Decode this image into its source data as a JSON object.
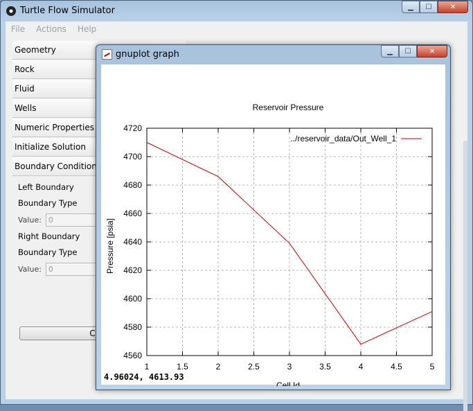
{
  "main": {
    "title": "Turtle Flow Simulator",
    "menu": [
      "File",
      "Actions",
      "Help"
    ],
    "sections": [
      "Geometry",
      "Rock",
      "Fluid",
      "Wells",
      "Numeric Properties",
      "Initialize Solution",
      "Boundary Condition"
    ],
    "boundary": {
      "left_label": "Left Boundary",
      "left_type_label": "Boundary Type",
      "left_value_label": "Value:",
      "left_value": "0",
      "right_label": "Right Boundary",
      "right_type_label": "Boundary Type",
      "right_value_label": "Value:",
      "right_value": "0"
    },
    "create_button": "Crea"
  },
  "gnuplot": {
    "title": "gnuplot graph",
    "coords": "4.96024,  4613.93"
  },
  "chart_data": {
    "type": "line",
    "title": "Reservoir Pressure",
    "xlabel": "Cell Id",
    "ylabel": "Pressure [psia]",
    "xlim": [
      1,
      5
    ],
    "ylim": [
      4560,
      4720
    ],
    "xticks": [
      "1",
      "1.5",
      "2",
      "2.5",
      "3",
      "3.5",
      "4",
      "4.5",
      "5"
    ],
    "yticks": [
      "4560",
      "4580",
      "4600",
      "4620",
      "4640",
      "4660",
      "4680",
      "4700",
      "4720"
    ],
    "grid": true,
    "legend_position": "top-right",
    "series": [
      {
        "name": "../reservoir_data/Out_Well_1",
        "color": "#cc0000",
        "x": [
          1,
          2,
          3,
          4,
          5
        ],
        "y": [
          4710,
          4686,
          4639,
          4568,
          4591
        ]
      }
    ]
  }
}
